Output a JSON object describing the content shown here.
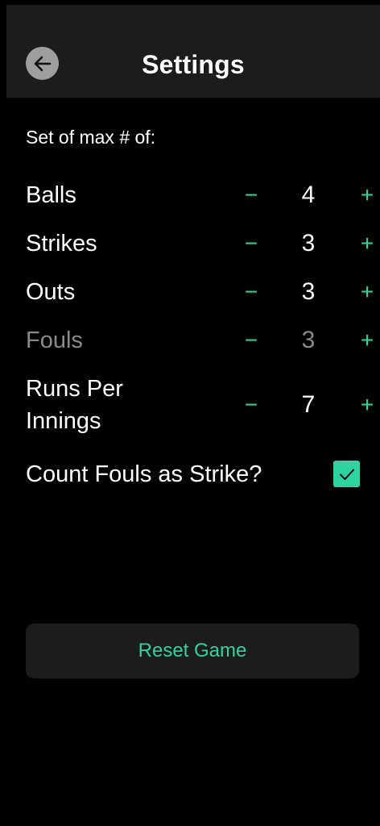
{
  "header": {
    "title": "Settings",
    "back_icon": "arrow-left-icon"
  },
  "section_label": "Set of max # of:",
  "colors": {
    "accent": "#2ed3a0",
    "background": "#000000",
    "surface": "#1c1c1c",
    "disabled_text": "#8a8a8a"
  },
  "counters": [
    {
      "label": "Balls",
      "value": "4",
      "minus": "−",
      "plus": "+",
      "disabled": false
    },
    {
      "label": "Strikes",
      "value": "3",
      "minus": "−",
      "plus": "+",
      "disabled": false
    },
    {
      "label": "Outs",
      "value": "3",
      "minus": "−",
      "plus": "+",
      "disabled": false
    },
    {
      "label": "Fouls",
      "value": "3",
      "minus": "−",
      "plus": "+",
      "disabled": true
    },
    {
      "label": "Runs Per Innings",
      "value": "7",
      "minus": "−",
      "plus": "+",
      "disabled": false
    }
  ],
  "count_fouls": {
    "label": "Count Fouls as Strike?",
    "checked": true
  },
  "reset_label": "Reset Game"
}
